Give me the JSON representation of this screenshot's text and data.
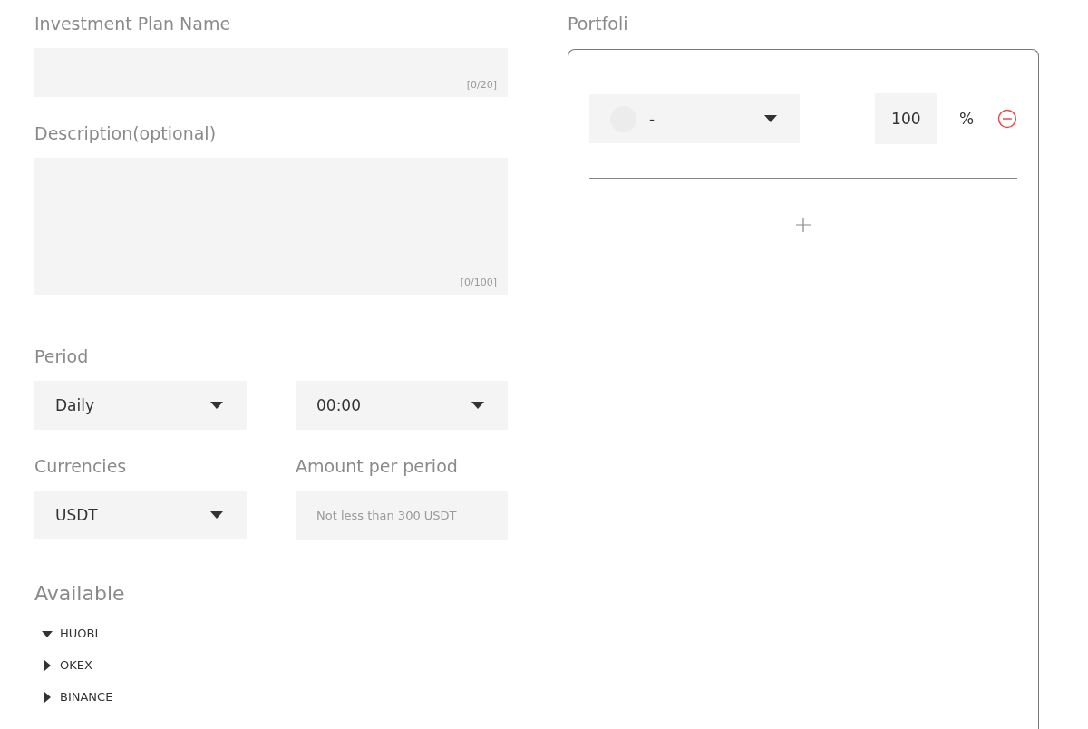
{
  "name_field": {
    "label": "Investment Plan Name",
    "counter": "[0/20]"
  },
  "description_field": {
    "label": "Description(optional)",
    "counter": "[0/100]"
  },
  "period": {
    "label": "Period",
    "frequency": "Daily",
    "time": "00:00"
  },
  "currencies": {
    "label": "Currencies",
    "value": "USDT"
  },
  "amount": {
    "label": "Amount per period",
    "placeholder": "Not less than 300 USDT"
  },
  "available": {
    "label": "Available",
    "items": [
      {
        "label": "HUOBI",
        "expanded": true
      },
      {
        "label": "OKEX",
        "expanded": false
      },
      {
        "label": "BINANCE",
        "expanded": false
      }
    ]
  },
  "portfolio": {
    "title": "Portfoli",
    "rows": [
      {
        "asset": "-",
        "percent": "100",
        "unit": "%"
      }
    ]
  }
}
